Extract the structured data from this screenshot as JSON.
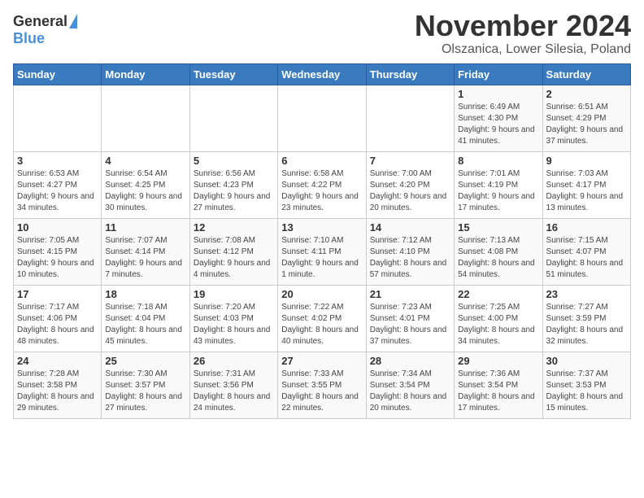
{
  "header": {
    "logo_general": "General",
    "logo_blue": "Blue",
    "month_title": "November 2024",
    "location": "Olszanica, Lower Silesia, Poland"
  },
  "days_of_week": [
    "Sunday",
    "Monday",
    "Tuesday",
    "Wednesday",
    "Thursday",
    "Friday",
    "Saturday"
  ],
  "weeks": [
    [
      {
        "day": "",
        "info": ""
      },
      {
        "day": "",
        "info": ""
      },
      {
        "day": "",
        "info": ""
      },
      {
        "day": "",
        "info": ""
      },
      {
        "day": "",
        "info": ""
      },
      {
        "day": "1",
        "info": "Sunrise: 6:49 AM\nSunset: 4:30 PM\nDaylight: 9 hours and 41 minutes."
      },
      {
        "day": "2",
        "info": "Sunrise: 6:51 AM\nSunset: 4:29 PM\nDaylight: 9 hours and 37 minutes."
      }
    ],
    [
      {
        "day": "3",
        "info": "Sunrise: 6:53 AM\nSunset: 4:27 PM\nDaylight: 9 hours and 34 minutes."
      },
      {
        "day": "4",
        "info": "Sunrise: 6:54 AM\nSunset: 4:25 PM\nDaylight: 9 hours and 30 minutes."
      },
      {
        "day": "5",
        "info": "Sunrise: 6:56 AM\nSunset: 4:23 PM\nDaylight: 9 hours and 27 minutes."
      },
      {
        "day": "6",
        "info": "Sunrise: 6:58 AM\nSunset: 4:22 PM\nDaylight: 9 hours and 23 minutes."
      },
      {
        "day": "7",
        "info": "Sunrise: 7:00 AM\nSunset: 4:20 PM\nDaylight: 9 hours and 20 minutes."
      },
      {
        "day": "8",
        "info": "Sunrise: 7:01 AM\nSunset: 4:19 PM\nDaylight: 9 hours and 17 minutes."
      },
      {
        "day": "9",
        "info": "Sunrise: 7:03 AM\nSunset: 4:17 PM\nDaylight: 9 hours and 13 minutes."
      }
    ],
    [
      {
        "day": "10",
        "info": "Sunrise: 7:05 AM\nSunset: 4:15 PM\nDaylight: 9 hours and 10 minutes."
      },
      {
        "day": "11",
        "info": "Sunrise: 7:07 AM\nSunset: 4:14 PM\nDaylight: 9 hours and 7 minutes."
      },
      {
        "day": "12",
        "info": "Sunrise: 7:08 AM\nSunset: 4:12 PM\nDaylight: 9 hours and 4 minutes."
      },
      {
        "day": "13",
        "info": "Sunrise: 7:10 AM\nSunset: 4:11 PM\nDaylight: 9 hours and 1 minute."
      },
      {
        "day": "14",
        "info": "Sunrise: 7:12 AM\nSunset: 4:10 PM\nDaylight: 8 hours and 57 minutes."
      },
      {
        "day": "15",
        "info": "Sunrise: 7:13 AM\nSunset: 4:08 PM\nDaylight: 8 hours and 54 minutes."
      },
      {
        "day": "16",
        "info": "Sunrise: 7:15 AM\nSunset: 4:07 PM\nDaylight: 8 hours and 51 minutes."
      }
    ],
    [
      {
        "day": "17",
        "info": "Sunrise: 7:17 AM\nSunset: 4:06 PM\nDaylight: 8 hours and 48 minutes."
      },
      {
        "day": "18",
        "info": "Sunrise: 7:18 AM\nSunset: 4:04 PM\nDaylight: 8 hours and 45 minutes."
      },
      {
        "day": "19",
        "info": "Sunrise: 7:20 AM\nSunset: 4:03 PM\nDaylight: 8 hours and 43 minutes."
      },
      {
        "day": "20",
        "info": "Sunrise: 7:22 AM\nSunset: 4:02 PM\nDaylight: 8 hours and 40 minutes."
      },
      {
        "day": "21",
        "info": "Sunrise: 7:23 AM\nSunset: 4:01 PM\nDaylight: 8 hours and 37 minutes."
      },
      {
        "day": "22",
        "info": "Sunrise: 7:25 AM\nSunset: 4:00 PM\nDaylight: 8 hours and 34 minutes."
      },
      {
        "day": "23",
        "info": "Sunrise: 7:27 AM\nSunset: 3:59 PM\nDaylight: 8 hours and 32 minutes."
      }
    ],
    [
      {
        "day": "24",
        "info": "Sunrise: 7:28 AM\nSunset: 3:58 PM\nDaylight: 8 hours and 29 minutes."
      },
      {
        "day": "25",
        "info": "Sunrise: 7:30 AM\nSunset: 3:57 PM\nDaylight: 8 hours and 27 minutes."
      },
      {
        "day": "26",
        "info": "Sunrise: 7:31 AM\nSunset: 3:56 PM\nDaylight: 8 hours and 24 minutes."
      },
      {
        "day": "27",
        "info": "Sunrise: 7:33 AM\nSunset: 3:55 PM\nDaylight: 8 hours and 22 minutes."
      },
      {
        "day": "28",
        "info": "Sunrise: 7:34 AM\nSunset: 3:54 PM\nDaylight: 8 hours and 20 minutes."
      },
      {
        "day": "29",
        "info": "Sunrise: 7:36 AM\nSunset: 3:54 PM\nDaylight: 8 hours and 17 minutes."
      },
      {
        "day": "30",
        "info": "Sunrise: 7:37 AM\nSunset: 3:53 PM\nDaylight: 8 hours and 15 minutes."
      }
    ]
  ]
}
